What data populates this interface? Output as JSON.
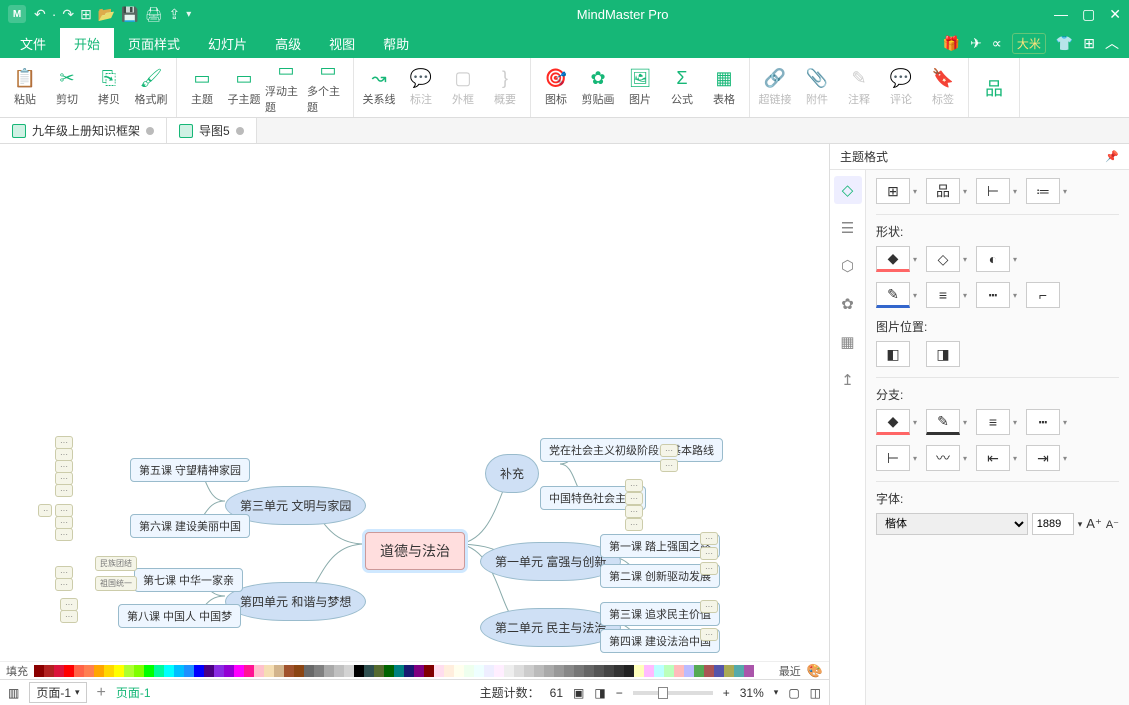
{
  "app": {
    "title": "MindMaster Pro",
    "user": "大米"
  },
  "menu": {
    "items": [
      "文件",
      "开始",
      "页面样式",
      "幻灯片",
      "高级",
      "视图",
      "帮助"
    ],
    "active": 1
  },
  "ribbon": {
    "groups": [
      [
        {
          "l": "粘贴",
          "i": "📋"
        },
        {
          "l": "剪切",
          "i": "✂"
        },
        {
          "l": "拷贝",
          "i": "⎘"
        },
        {
          "l": "格式刷",
          "i": "🖌"
        }
      ],
      [
        {
          "l": "主题",
          "i": "▭"
        },
        {
          "l": "子主题",
          "i": "▭"
        },
        {
          "l": "浮动主题",
          "i": "▭"
        },
        {
          "l": "多个主题",
          "i": "▭"
        }
      ],
      [
        {
          "l": "关系线",
          "i": "↝"
        },
        {
          "l": "标注",
          "i": "💬",
          "dim": true
        },
        {
          "l": "外框",
          "i": "▢",
          "dim": true
        },
        {
          "l": "概要",
          "i": "}",
          "dim": true
        }
      ],
      [
        {
          "l": "图标",
          "i": "🎯"
        },
        {
          "l": "剪贴画",
          "i": "✿"
        },
        {
          "l": "图片",
          "i": "🖼"
        },
        {
          "l": "公式",
          "i": "Σ"
        },
        {
          "l": "表格",
          "i": "▦"
        }
      ],
      [
        {
          "l": "超链接",
          "i": "🔗",
          "dim": true
        },
        {
          "l": "附件",
          "i": "📎",
          "dim": true
        },
        {
          "l": "注释",
          "i": "✎",
          "dim": true
        },
        {
          "l": "评论",
          "i": "💬",
          "dim": true
        },
        {
          "l": "标签",
          "i": "🔖",
          "dim": true
        }
      ],
      [
        {
          "l": "",
          "i": "品"
        }
      ]
    ]
  },
  "tabs": [
    {
      "label": "九年级上册知识框架"
    },
    {
      "label": "导图5"
    }
  ],
  "mindmap": {
    "root": "道德与法治",
    "补充": "补充",
    "u1": "第一单元 富强与创新",
    "u2": "第二单元 民主与法治",
    "u3": "第三单元 文明与家园",
    "u4": "第四单元 和谐与梦想",
    "l1a": "第一课 踏上强国之路",
    "l1b": "第二课 创新驱动发展",
    "l2a": "第三课 追求民主价值",
    "l2b": "第四课 建设法治中国",
    "l3a": "第五课 守望精神家园",
    "l3b": "第六课 建设美丽中国",
    "l4a": "第七课 中华一家亲",
    "l4b": "第八课 中国人 中国梦",
    "ext1": "党在社会主义初级阶段的基本路线",
    "ext2": "中国特色社会主义",
    "t4a1": "民族团结",
    "t4a2": "祖国统一"
  },
  "panel": {
    "title": "主题格式",
    "shape": "形状:",
    "imgpos": "图片位置:",
    "branch": "分支:",
    "font": "字体:",
    "fontname": "楷体",
    "fontsize": "1889"
  },
  "colorbar": {
    "fill": "填充",
    "recent": "最近"
  },
  "status": {
    "page": "页面-1",
    "pageTab": "页面-1",
    "count_lbl": "主题计数：",
    "count": "61",
    "zoom": "31%"
  }
}
